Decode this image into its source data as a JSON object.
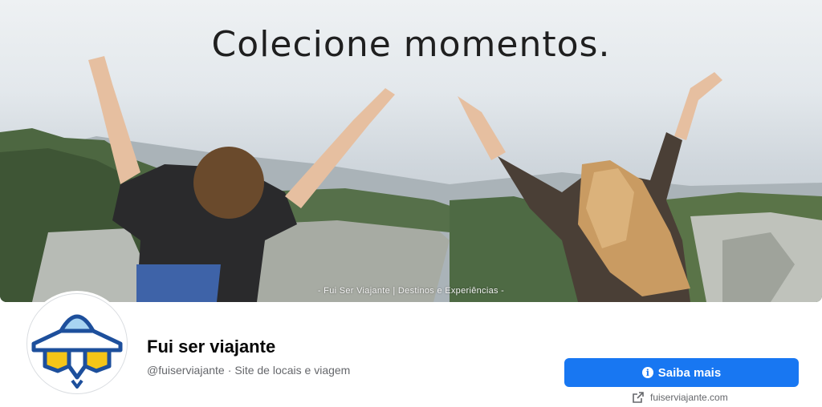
{
  "cover": {
    "headline": "Colecione momentos.",
    "caption": "- Fui Ser Viajante | Destinos e Experiências -"
  },
  "profile": {
    "name": "Fui ser viajante",
    "handle": "@fuiserviajante",
    "separator": "·",
    "category": "Site de locais e viagem"
  },
  "cta": {
    "label": "Saiba mais",
    "icon": "info-icon"
  },
  "website": {
    "icon": "external-link-icon",
    "label": "fuiserviajante.com"
  },
  "colors": {
    "primary": "#1877f2",
    "logo_blue": "#1d4f9c",
    "logo_light_blue": "#a8d4f2",
    "logo_yellow": "#f5c518"
  }
}
